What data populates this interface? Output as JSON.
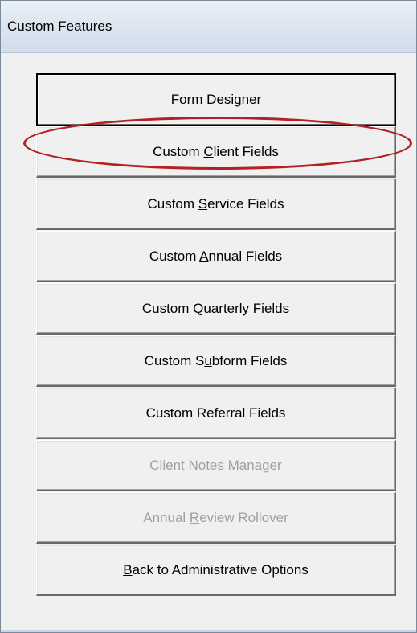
{
  "window": {
    "title": "Custom Features"
  },
  "buttons": [
    {
      "pre": "",
      "acc": "F",
      "post": "orm Designer",
      "state": "default"
    },
    {
      "pre": "Custom ",
      "acc": "C",
      "post": "lient Fields",
      "state": "enabled"
    },
    {
      "pre": "Custom ",
      "acc": "S",
      "post": "ervice Fields",
      "state": "enabled"
    },
    {
      "pre": "Custom ",
      "acc": "A",
      "post": "nnual Fields",
      "state": "enabled"
    },
    {
      "pre": "Custom ",
      "acc": "Q",
      "post": "uarterly Fields",
      "state": "enabled"
    },
    {
      "pre": "Custom S",
      "acc": "u",
      "post": "bform Fields",
      "state": "enabled"
    },
    {
      "pre": "Custom Referral Fields",
      "acc": "",
      "post": "",
      "state": "enabled"
    },
    {
      "pre": "Client Notes Manager",
      "acc": "",
      "post": "",
      "state": "disabled"
    },
    {
      "pre": "Annual ",
      "acc": "R",
      "post": "eview Rollover",
      "state": "disabled"
    },
    {
      "pre": "",
      "acc": "B",
      "post": "ack to Administrative Options",
      "state": "enabled"
    }
  ],
  "annotation": {
    "highlight_color": "#b22222",
    "highlighted_button_index": 1
  },
  "colors": {
    "window_bg": "#f0f0f0",
    "disabled_text": "#a0a0a0"
  }
}
